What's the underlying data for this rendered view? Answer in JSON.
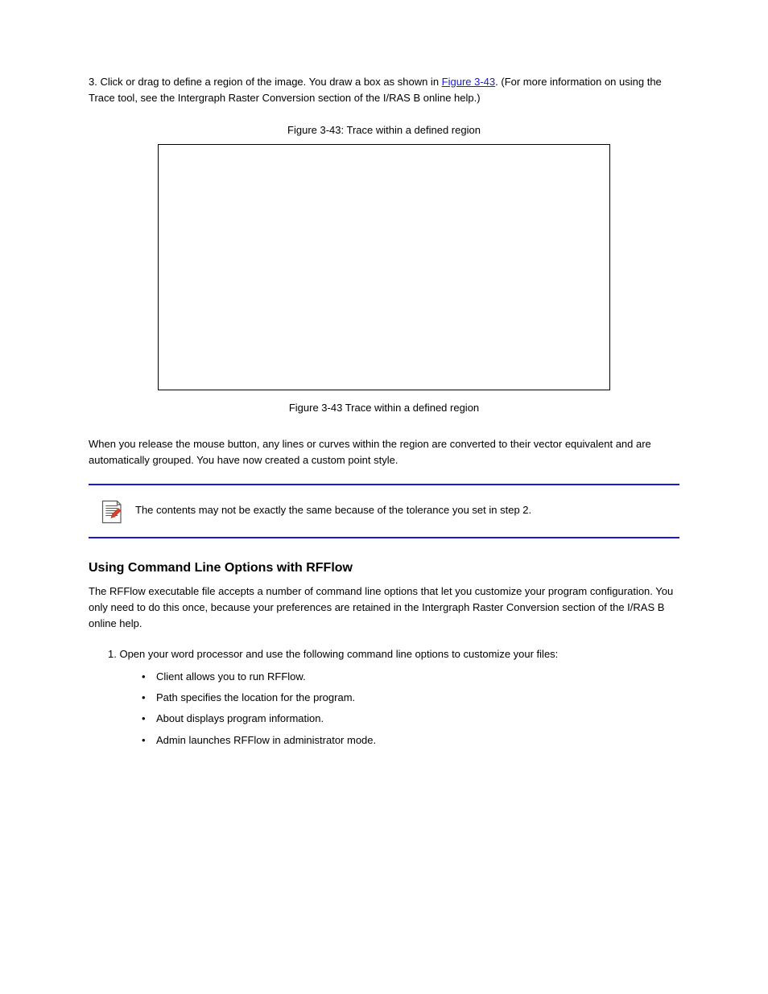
{
  "intro": {
    "before_link": "3. Click or drag to define a region of the image. You draw a box as shown in ",
    "link_text": "Figure 3-43",
    "after_link": ". (For more information on using the Trace tool, see the Intergraph Raster Conversion section of the I/RAS B online help.)"
  },
  "figure": {
    "top_caption": "Figure 3-43: Trace within a defined region",
    "bottom_caption": "Figure 3-43 Trace within a defined region"
  },
  "para_after_figure": "When you release the mouse button, any lines or curves within the region are converted to their vector equivalent and are automatically grouped. You have now created a custom point style.",
  "note_text": "The contents may not be exactly the same because of the tolerance you set in step 2.",
  "section": {
    "heading": "Using Command Line Options with RFFlow",
    "body": "The RFFlow executable file accepts a number of command line options that let you customize your program configuration. You only need to do this once, because your preferences are retained in the Intergraph Raster Conversion section of the I/RAS B online help.",
    "list_intro": "1. Open your word processor and use the following command line options to customize your files:",
    "bullets": [
      {
        "opt": "Client",
        "desc": " allows you to run RFFlow."
      },
      {
        "opt": "Path",
        "desc": " specifies the location for the program."
      },
      {
        "opt": "About",
        "desc": " displays program information."
      },
      {
        "opt": "Admin",
        "desc": " launches RFFlow in administrator mode."
      }
    ]
  }
}
